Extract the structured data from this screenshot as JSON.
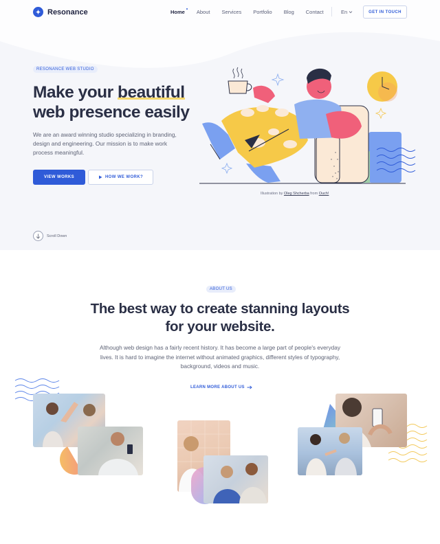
{
  "nav": {
    "brand": "Resonance",
    "menu": [
      "Home",
      "About",
      "Services",
      "Portfolio",
      "Blog",
      "Contact"
    ],
    "language": "En",
    "cta": "GET IN TOUCH"
  },
  "hero": {
    "tag": "RESONANCE WEB STUDIO",
    "title_line1_pre": "Make your ",
    "title_highlight": "beautiful",
    "title_line2": "web presence easily",
    "text": "We are an award winning studio specializing in branding, design and engineering. Our mission is to make work process meaningful.",
    "btn_primary": "VIEW WORKS",
    "btn_secondary": "HOW WE WORK?",
    "credit_pre": "Illustration by ",
    "credit_author": "Oleg Shcherba",
    "credit_mid": " from ",
    "credit_source": "Ouch!",
    "scroll_label": "Scroll Down"
  },
  "about": {
    "tag": "ABOUT US",
    "title": "The best way to create stanning layouts for your website.",
    "text": "Although web design has a fairly recent history. It has become a large part of people's everyday lives. It is hard to imagine the internet without animated graphics, different styles of typography, background, videos and music.",
    "link": "LEARN MORE ABOUT US"
  },
  "colors": {
    "accent": "#2f5bd8",
    "highlight": "#f6d86b",
    "text": "#2a2f45",
    "hero_bg": "#f5f6fa"
  },
  "icons": [
    "plus-logo-icon",
    "chevron-down-icon",
    "play-icon",
    "arrow-down-icon",
    "arrow-right-icon"
  ]
}
